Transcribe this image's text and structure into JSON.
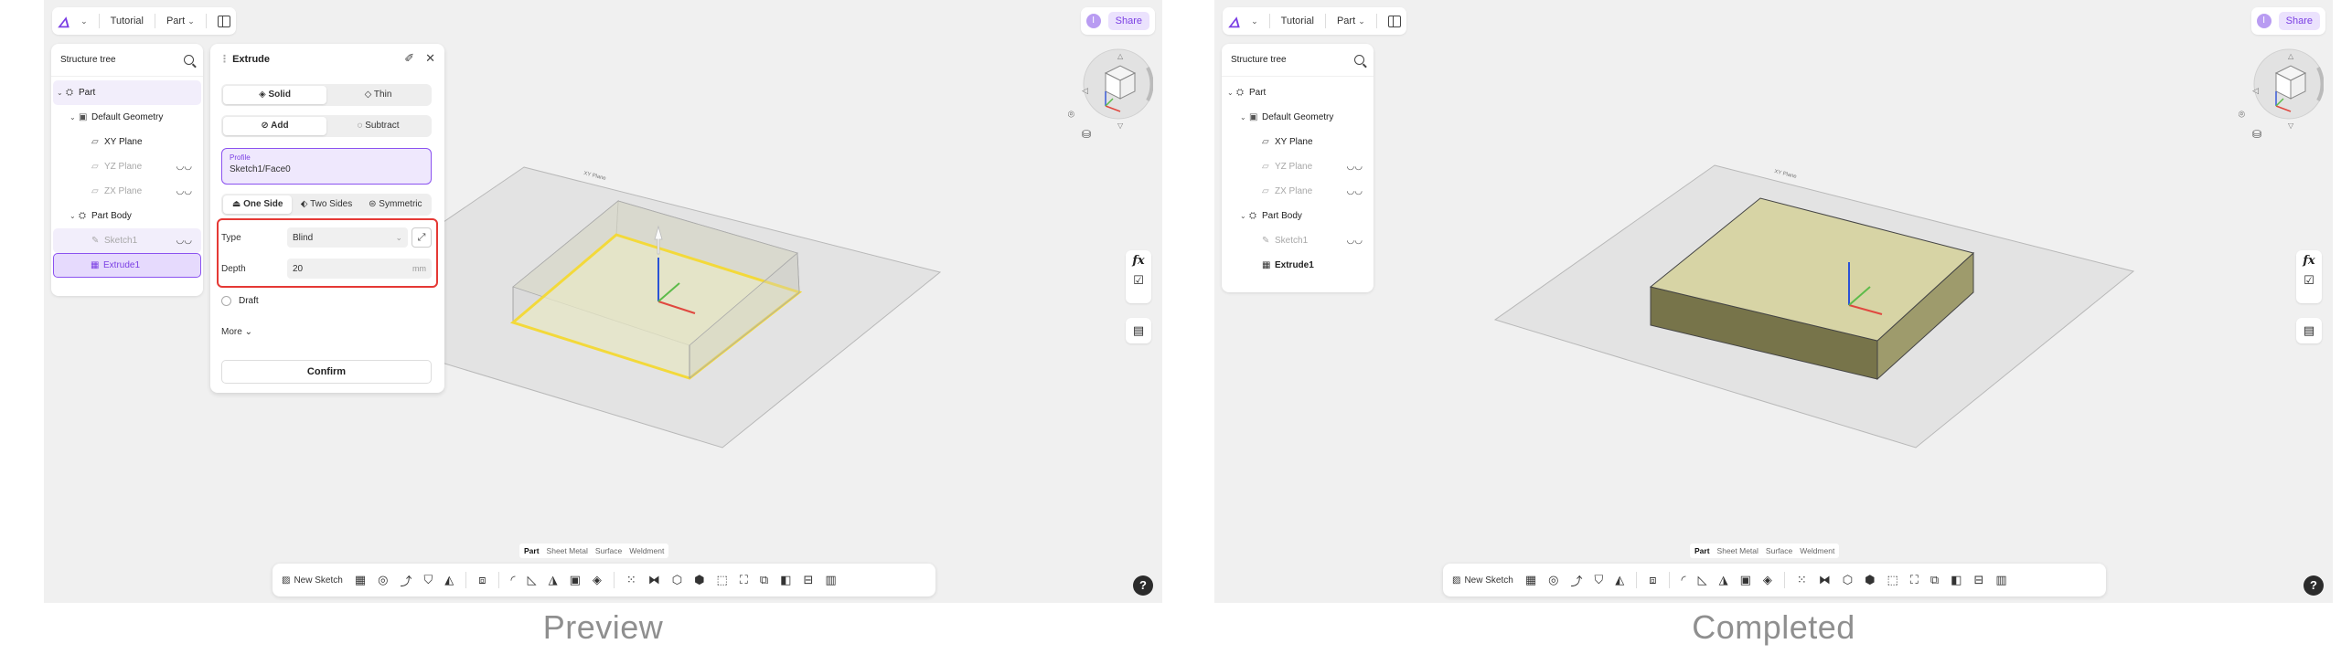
{
  "topbar": {
    "logo": "🜂",
    "project": "Tutorial",
    "mode_label": "Part",
    "avatar": "I",
    "share": "Share"
  },
  "tree": {
    "title": "Structure tree",
    "items": [
      {
        "label": "Part",
        "icon": "part-icon"
      },
      {
        "label": "Default Geometry",
        "icon": "geometry-icon"
      },
      {
        "label": "XY Plane",
        "icon": "plane-icon"
      },
      {
        "label": "YZ Plane",
        "icon": "plane-icon"
      },
      {
        "label": "ZX Plane",
        "icon": "plane-icon"
      },
      {
        "label": "Part Body",
        "icon": "body-icon"
      },
      {
        "label": "Sketch1",
        "icon": "sketch-icon"
      },
      {
        "label": "Extrude1",
        "icon": "extrude-icon"
      }
    ]
  },
  "extrude": {
    "title": "Extrude",
    "solid": "Solid",
    "thin": "Thin",
    "add": "Add",
    "subtract": "Subtract",
    "profile_label": "Profile",
    "profile_value": "Sketch1/Face0",
    "one_side": "One Side",
    "two_sides": "Two Sides",
    "symmetric": "Symmetric",
    "type_label": "Type",
    "type_value": "Blind",
    "depth_label": "Depth",
    "depth_value": "20",
    "depth_unit": "mm",
    "draft": "Draft",
    "more": "More",
    "confirm": "Confirm"
  },
  "scene": {
    "plane_label": "XY Plane"
  },
  "modes": {
    "part": "Part",
    "sheet_metal": "Sheet Metal",
    "surface": "Surface",
    "weldment": "Weldment"
  },
  "toolbar": {
    "new_sketch": "New Sketch"
  },
  "side": {
    "fx": "fx"
  },
  "help": "?",
  "captions": {
    "left": "Preview",
    "right": "Completed"
  },
  "colors": {
    "accent": "#7b3fe4",
    "highlight": "#e53935",
    "solid_top": "#d7d4a5",
    "solid_preview": "#e2e2cf"
  }
}
